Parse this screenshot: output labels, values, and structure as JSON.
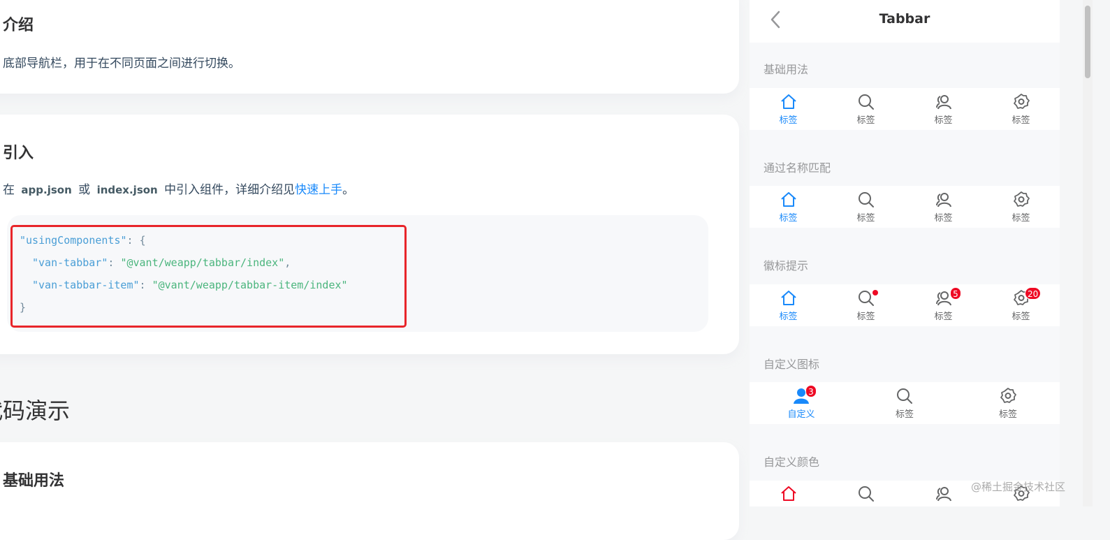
{
  "docs": {
    "intro": {
      "heading": "介绍",
      "text": "底部导航栏，用于在不同页面之间进行切换。"
    },
    "import": {
      "heading": "引入",
      "text_before": "在",
      "file1": "app.json",
      "text_or": "或",
      "file2": "index.json",
      "text_middle": "中引入组件，详细介绍见",
      "link": "快速上手",
      "text_end": "。",
      "code_line1_key": "\"usingComponents\"",
      "code_line1_rest": ": {",
      "code_line2_key": "\"van-tabbar\"",
      "code_line2_sep": ": ",
      "code_line2_val": "\"@vant/weapp/tabbar/index\"",
      "code_line2_end": ",",
      "code_line3_key": "\"van-tabbar-item\"",
      "code_line3_sep": ": ",
      "code_line3_val": "\"@vant/weapp/tabbar-item/index\"",
      "code_line4": "}"
    },
    "demo_heading": "代码演示",
    "basic_heading": "基础用法"
  },
  "phone": {
    "title": "Tabbar",
    "tab_label": "标签",
    "sections": {
      "basic": "基础用法",
      "name_match": "通过名称匹配",
      "badge": "徽标提示",
      "custom_icon": "自定义图标",
      "custom_color": "自定义颜色"
    },
    "badges": {
      "friends": "5",
      "setting": "20",
      "custom": "3"
    },
    "custom_label": "自定义"
  },
  "watermark": "@稀土掘金技术社区",
  "colors": {
    "active": "#1989fa",
    "inactive": "#646566",
    "badge": "#ee0a24",
    "highlight_frame": "#e8252a"
  },
  "icons": [
    "home-icon",
    "search-icon",
    "friends-icon",
    "setting-icon",
    "back-arrow-icon"
  ]
}
